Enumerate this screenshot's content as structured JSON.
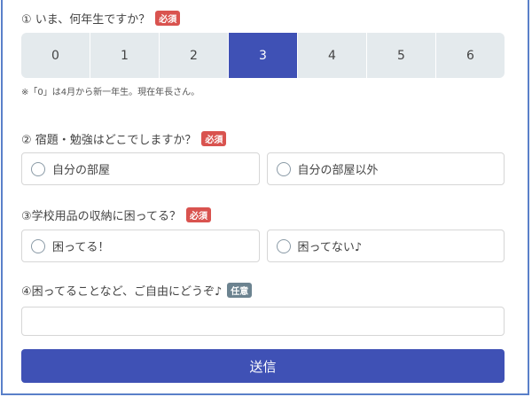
{
  "q1": {
    "label": "① いま、何年生ですか？",
    "badge": "必須",
    "options": [
      "0",
      "1",
      "2",
      "3",
      "4",
      "5",
      "6"
    ],
    "selected": "3",
    "note": "※「0」は4月から新一年生。現在年長さん。"
  },
  "q2": {
    "label": "② 宿題・勉強はどこでしますか？",
    "badge": "必須",
    "options": [
      "自分の部屋",
      "自分の部屋以外"
    ]
  },
  "q3": {
    "label": "③学校用品の収納に困ってる？",
    "badge": "必須",
    "options": [
      "困ってる！",
      "困ってない♪"
    ]
  },
  "q4": {
    "label": "④困ってることなど、ご自由にどうぞ♪",
    "badge": "任意",
    "value": ""
  },
  "submit": "送信"
}
